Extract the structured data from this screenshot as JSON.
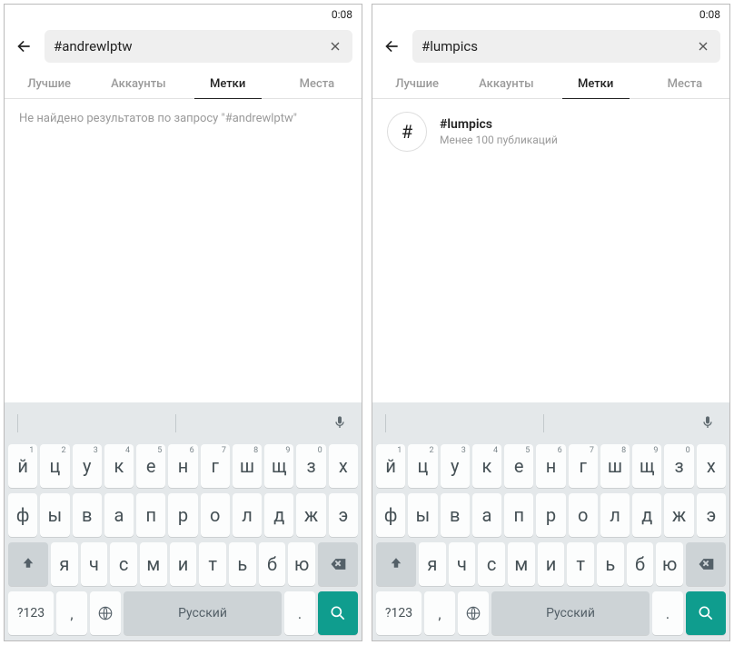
{
  "screens": [
    {
      "status_time": "0:08",
      "search_value": "#andrewlptw",
      "tabs": [
        "Лучшие",
        "Аккаунты",
        "Метки",
        "Места"
      ],
      "active_tab": 2,
      "no_results": "Не найдено результатов по запросу \"#andrewlptw\"",
      "result": null
    },
    {
      "status_time": "0:08",
      "search_value": "#lumpics",
      "tabs": [
        "Лучшие",
        "Аккаунты",
        "Метки",
        "Места"
      ],
      "active_tab": 2,
      "no_results": null,
      "result": {
        "title": "#lumpics",
        "sub": "Менее 100 публикаций"
      }
    }
  ],
  "keyboard": {
    "row1": [
      {
        "c": "й",
        "n": "1"
      },
      {
        "c": "ц",
        "n": "2"
      },
      {
        "c": "у",
        "n": "3"
      },
      {
        "c": "к",
        "n": "4"
      },
      {
        "c": "е",
        "n": "5"
      },
      {
        "c": "н",
        "n": "6"
      },
      {
        "c": "г",
        "n": "7"
      },
      {
        "c": "ш",
        "n": "8"
      },
      {
        "c": "щ",
        "n": "9"
      },
      {
        "c": "з",
        "n": "0"
      },
      {
        "c": "х",
        "n": ""
      }
    ],
    "row2": [
      "ф",
      "ы",
      "в",
      "а",
      "п",
      "р",
      "о",
      "л",
      "д",
      "ж",
      "э"
    ],
    "row3": [
      "я",
      "ч",
      "с",
      "м",
      "и",
      "т",
      "ь",
      "б",
      "ю"
    ],
    "space_label": "Русский",
    "num_label": "?123",
    "comma_label": ",",
    "period_label": "."
  }
}
